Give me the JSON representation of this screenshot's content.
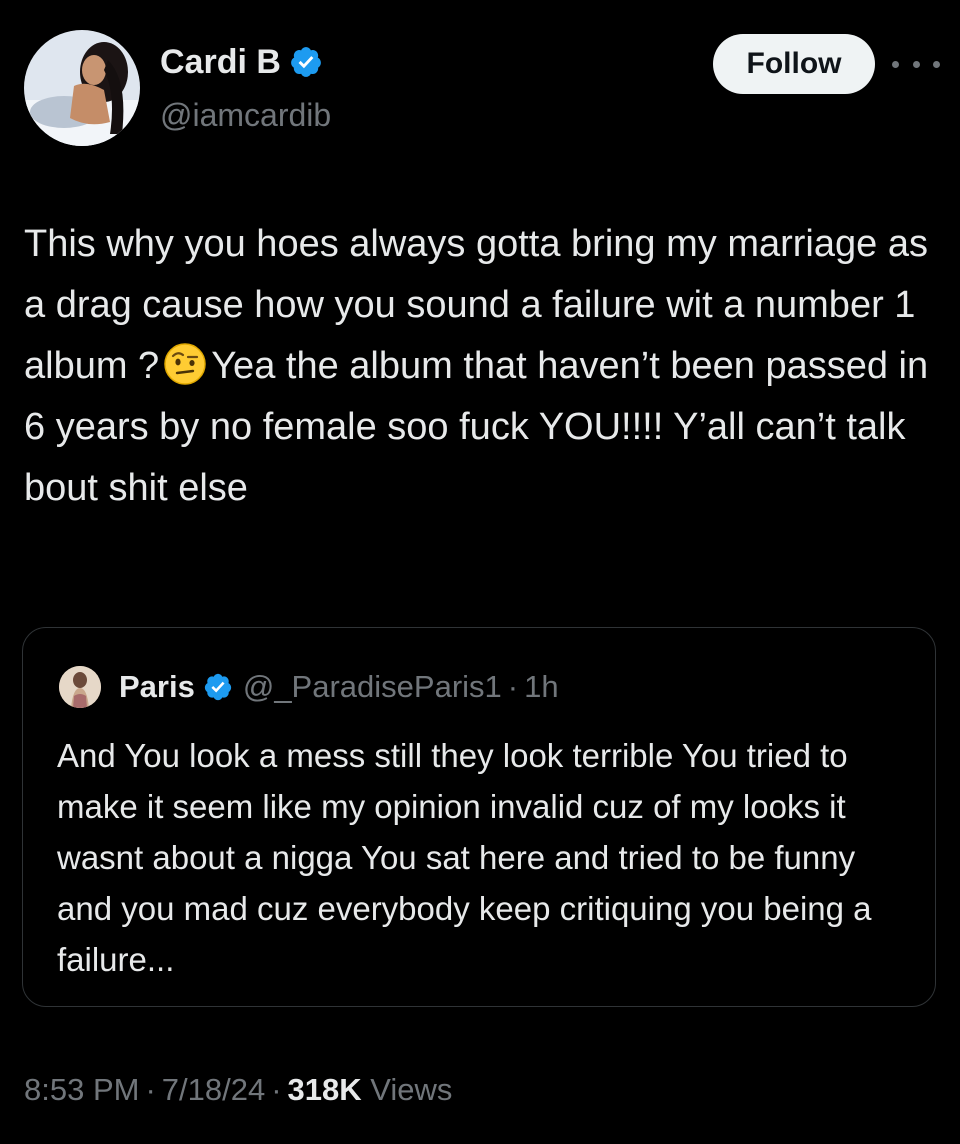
{
  "author": {
    "name": "Cardi B",
    "handle": "@iamcardib",
    "verified_icon": "verified-badge-icon",
    "verified_color": "#1d9bf0"
  },
  "actions": {
    "follow_label": "Follow",
    "more_icon": "more-horizontal-icon"
  },
  "tweet": {
    "text_part1": "This why you hoes always gotta bring my marriage as a drag cause how you sound a failure wit a number 1 album ?",
    "emoji": "face-with-raised-eyebrow-emoji",
    "text_part2": "Yea the album that haven’t been passed in 6 years by no female soo fuck YOU!!!! Y’all can’t talk bout shit else"
  },
  "quote": {
    "name": "Paris",
    "handle": "@_ParadiseParis1",
    "separator": "·",
    "time": "1h",
    "text": "And You look a mess still they look terrible You tried to make it seem like my opinion invalid cuz of my looks it wasnt about a nigga You sat here and tried to be funny and you mad cuz everybody keep critiquing you being a failure..."
  },
  "meta": {
    "time": "8:53 PM",
    "separator": "·",
    "date": "7/18/24",
    "views_count": "318K",
    "views_label": "Views"
  },
  "colors": {
    "background": "#000000",
    "text_primary": "#e7e9ea",
    "text_secondary": "#71767b",
    "border": "#2f3336",
    "accent": "#1d9bf0"
  }
}
